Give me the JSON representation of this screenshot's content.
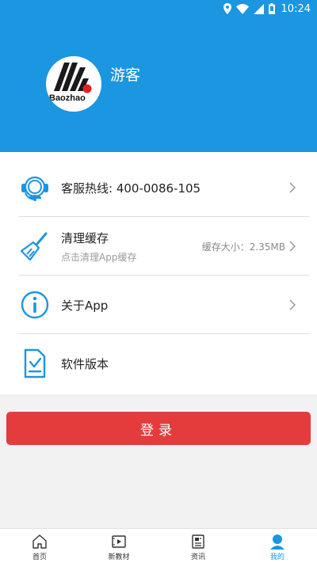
{
  "status_bar": {
    "time": "10:24"
  },
  "profile": {
    "avatar_text": "Baozhao",
    "username": "游客"
  },
  "menu": {
    "items": [
      {
        "title": "客服热线: 400-0086-105",
        "icon": "headset-icon"
      },
      {
        "title": "清理缓存",
        "subtitle": "点击清理App缓存",
        "value": "缓存大小：2.35MB",
        "icon": "broom-icon"
      },
      {
        "title": "关于App",
        "icon": "info-icon"
      },
      {
        "title": "软件版本",
        "icon": "document-check-icon"
      }
    ]
  },
  "login_button": {
    "label": "登录"
  },
  "tabbar": {
    "tabs": [
      {
        "label": "首页",
        "icon": "home-icon"
      },
      {
        "label": "新教材",
        "icon": "video-icon"
      },
      {
        "label": "资讯",
        "icon": "news-icon"
      },
      {
        "label": "我的",
        "icon": "user-icon",
        "active": true
      }
    ]
  },
  "colors": {
    "primary": "#1b96e0",
    "login": "#e43c3c"
  }
}
